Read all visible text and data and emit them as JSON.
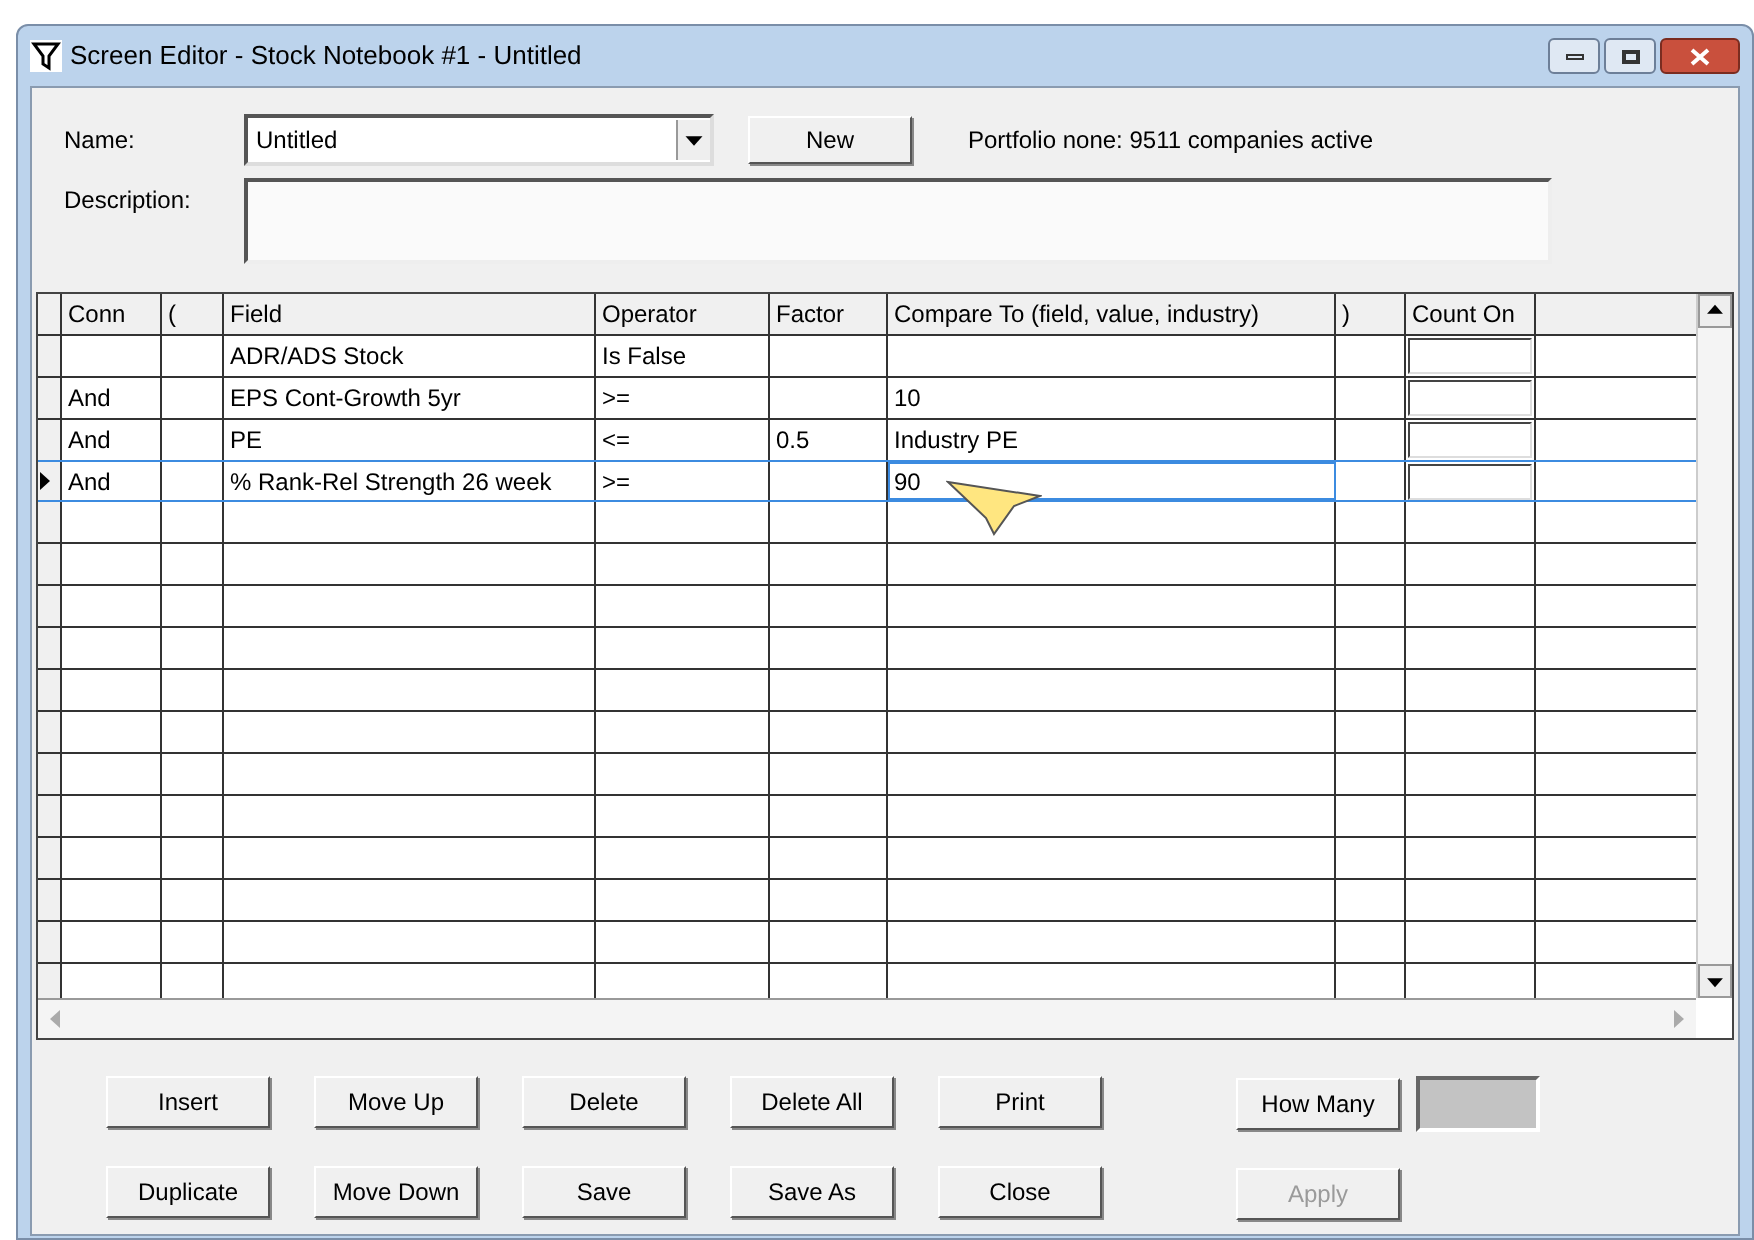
{
  "window": {
    "title": "Screen Editor - Stock Notebook #1 - Untitled"
  },
  "name_field": {
    "label": "Name:",
    "value": "Untitled"
  },
  "new_button": "New",
  "portfolio_status": "Portfolio none: 9511 companies active",
  "description_field": {
    "label": "Description:"
  },
  "grid": {
    "columns": [
      "Conn",
      "(",
      "Field",
      "Operator",
      "Factor",
      "Compare To (field, value, industry)",
      ")",
      "Count On"
    ],
    "rows": [
      {
        "cells": [
          "",
          "",
          "ADR/ADS Stock",
          "Is False",
          "",
          "",
          "",
          ""
        ],
        "selected": false
      },
      {
        "cells": [
          "And",
          "",
          "EPS Cont-Growth 5yr",
          ">=",
          "",
          "10",
          "",
          ""
        ],
        "selected": false
      },
      {
        "cells": [
          "And",
          "",
          "PE",
          "<=",
          "0.5",
          "Industry PE",
          "",
          ""
        ],
        "selected": false
      },
      {
        "cells": [
          "And",
          "",
          "% Rank-Rel Strength 26 week",
          ">=",
          "",
          "90",
          "",
          ""
        ],
        "selected": true
      }
    ]
  },
  "buttons": [
    {
      "label": "Insert",
      "disabled": false
    },
    {
      "label": "Move Up",
      "disabled": false
    },
    {
      "label": "Delete",
      "disabled": false
    },
    {
      "label": "Delete All",
      "disabled": false
    },
    {
      "label": "Print",
      "disabled": false
    },
    {
      "label": "How Many",
      "disabled": false
    },
    {
      "label": "Duplicate",
      "disabled": false
    },
    {
      "label": "Move Down",
      "disabled": false
    },
    {
      "label": "Save",
      "disabled": false
    },
    {
      "label": "Save As",
      "disabled": false
    },
    {
      "label": "Close",
      "disabled": false
    },
    {
      "label": "Apply",
      "disabled": true
    }
  ]
}
